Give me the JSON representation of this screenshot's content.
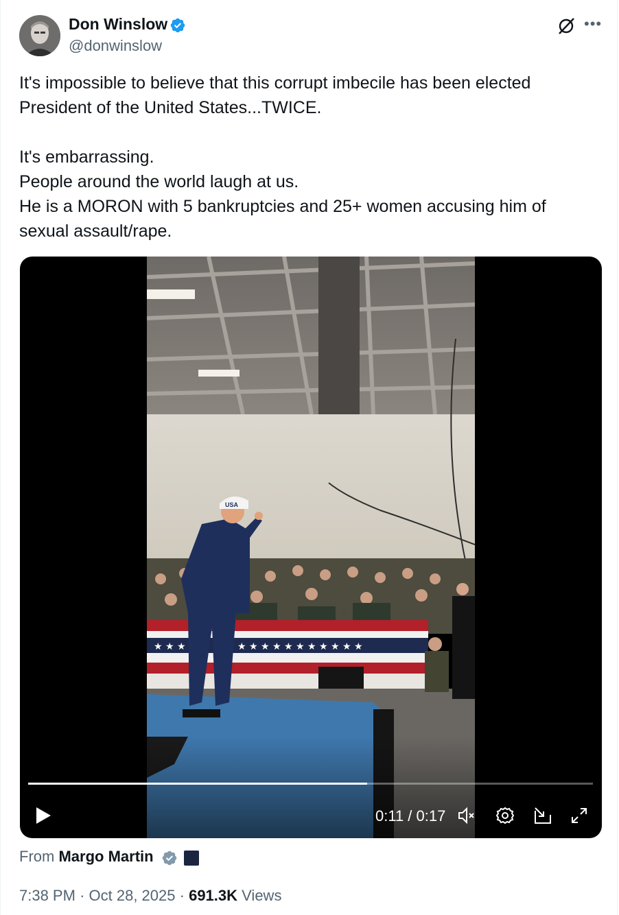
{
  "author": {
    "name": "Don Winslow",
    "handle": "@donwinslow"
  },
  "tweet": {
    "text": "It's impossible to believe that this corrupt imbecile has been elected President of the United States...TWICE.\n\nIt's embarrassing.\nPeople around the world laugh at us.\nHe is a MORON with 5 bankruptcies and 25+ women accusing him of sexual assault/rape."
  },
  "video": {
    "time_display": "0:11 / 0:17",
    "progress": 0.6,
    "hat_text": "USA"
  },
  "attribution": {
    "prefix": "From",
    "name": "Margo Martin"
  },
  "meta": {
    "time": "7:38 PM",
    "separator": "·",
    "date": "Oct 28, 2025",
    "views_count": "691.3K",
    "views_label": "Views"
  },
  "icons": {
    "verified": "verified-badge-icon",
    "grok": "grok-icon",
    "more": "more-icon",
    "play": "play-icon",
    "mute": "mute-icon",
    "settings": "settings-icon",
    "pip": "pip-icon",
    "fullscreen": "fullscreen-icon"
  },
  "colors": {
    "verified_blue": "#1d9bf0",
    "secondary_text": "#536471",
    "primary_text": "#0f1419"
  }
}
